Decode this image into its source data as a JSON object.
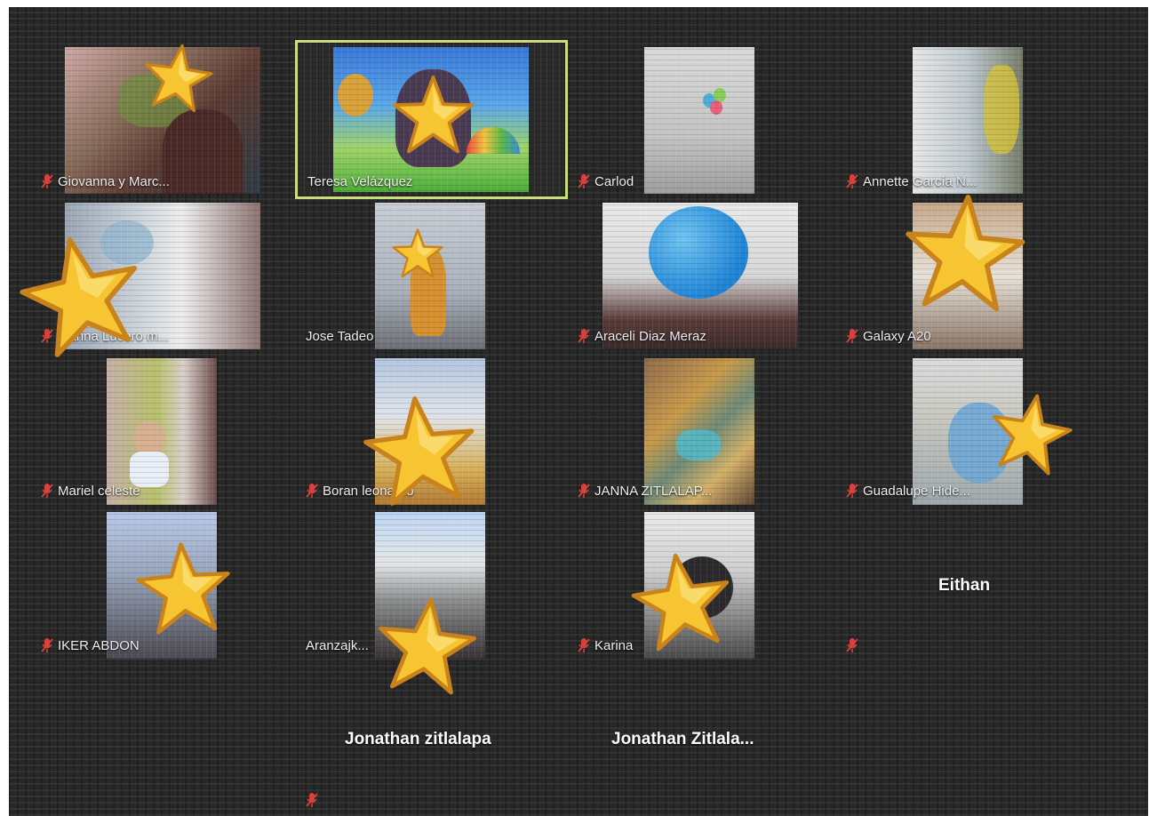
{
  "meeting": {
    "participants": [
      {
        "id": "giovanna",
        "name": "Giovanna y Marc..."
      },
      {
        "id": "teresa",
        "name": "Teresa Velázquez"
      },
      {
        "id": "carlod",
        "name": "Carlod"
      },
      {
        "id": "annette",
        "name": "Annette García N..."
      },
      {
        "id": "lucero",
        "name": "Marina Lucero m..."
      },
      {
        "id": "jose",
        "name": "Jose Tadeo"
      },
      {
        "id": "araceli",
        "name": "Araceli Diaz Meraz"
      },
      {
        "id": "galaxy",
        "name": "Galaxy A20"
      },
      {
        "id": "mariel",
        "name": "Mariel celeste"
      },
      {
        "id": "boran",
        "name": "Boran leonardo"
      },
      {
        "id": "janna",
        "name": "JANNA ZITLALAP..."
      },
      {
        "id": "guadalupe",
        "name": "Guadalupe Hide..."
      },
      {
        "id": "iker",
        "name": "IKER ABDON"
      },
      {
        "id": "aranza",
        "name": "Aranzajk..."
      },
      {
        "id": "karina",
        "name": "Karina"
      },
      {
        "id": "eithan",
        "name": "Eithan"
      },
      {
        "id": "jonathan1",
        "name": "Jonathan zitlalapa"
      },
      {
        "id": "jonathan2",
        "name": "Jonathan  Zitlala..."
      }
    ],
    "active_speaker": "Teresa Velázquez"
  },
  "icons": {
    "muted_mic": "muted-mic-icon",
    "star": "star-sticker-icon"
  },
  "colors": {
    "background": "#262626",
    "speaker_highlight": "#c9e07a",
    "muted_red": "#d9423a",
    "star_fill": "#f6c531",
    "star_edge": "#c9831c"
  }
}
